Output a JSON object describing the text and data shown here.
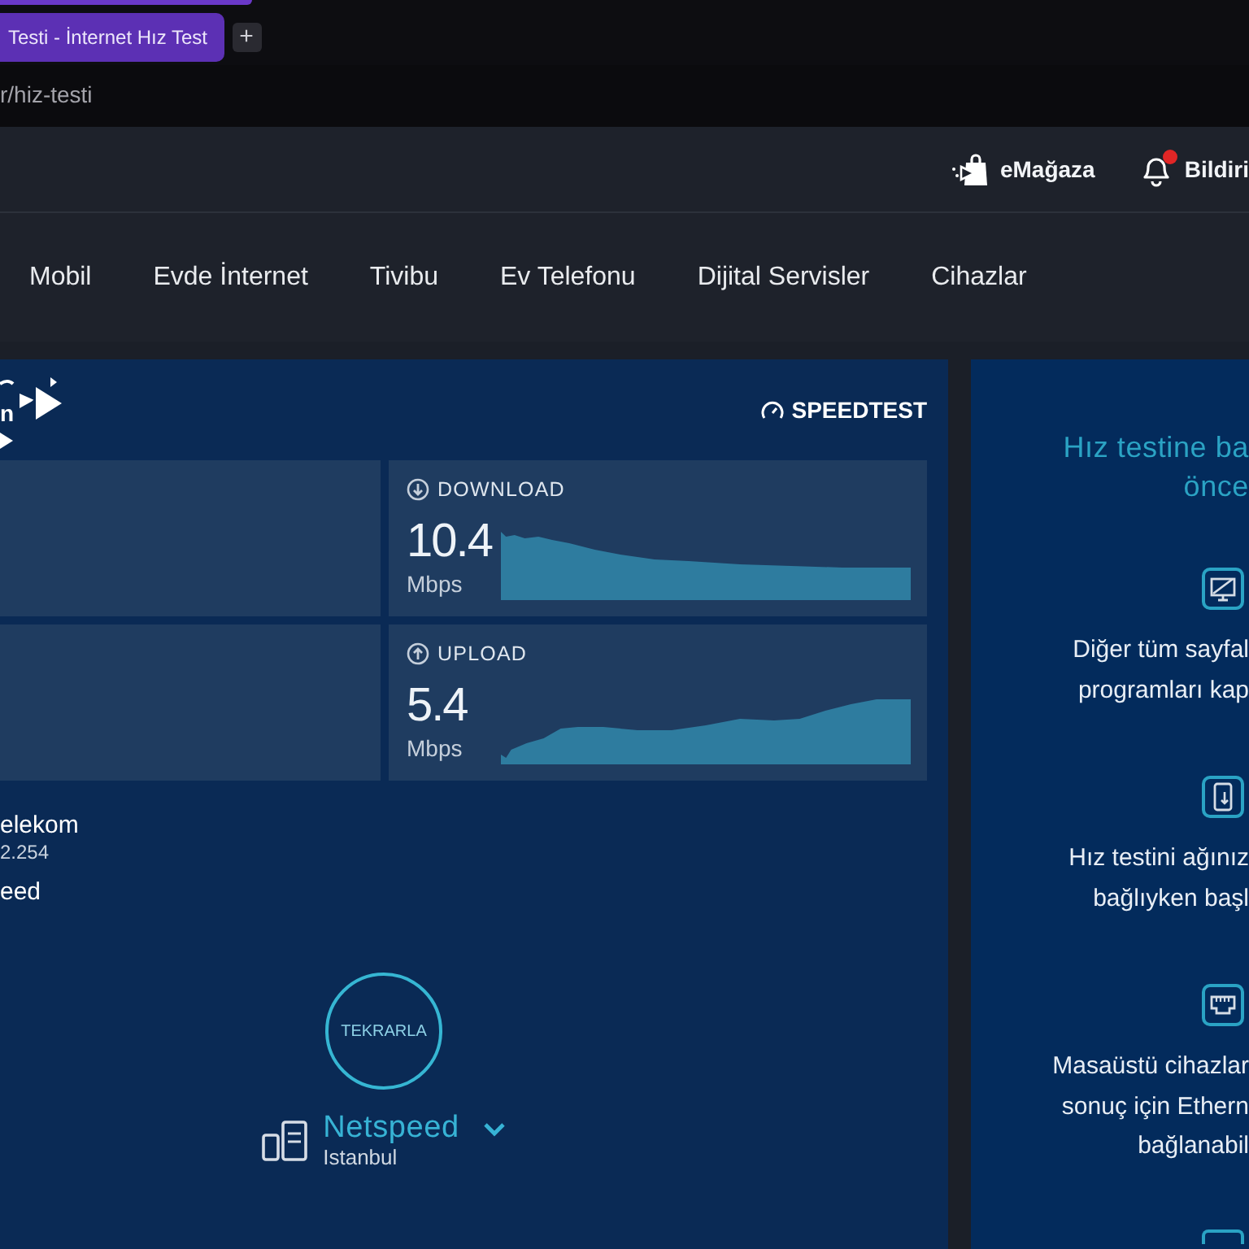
{
  "browser": {
    "tabs": [
      {
        "title": "Testi - İnternet Hız Test",
        "selected": true
      }
    ],
    "new_tab": "+",
    "address": "r/hiz-testi"
  },
  "header": {
    "links": [
      {
        "kind": "store",
        "label": "eMağaza"
      },
      {
        "kind": "notifications",
        "label": "Bildiri",
        "unread": true
      }
    ]
  },
  "nav": {
    "items": [
      "Mobil",
      "Evde İnternet",
      "Tivibu",
      "Ev Telefonu",
      "Dijital Servisler",
      "Cihazlar"
    ]
  },
  "speedtest": {
    "logo_text": "n",
    "title": "SPEEDTEST",
    "results": [
      {
        "kind": "empty"
      },
      {
        "kind": "download",
        "label": "DOWNLOAD",
        "value": "10.4",
        "unit": "Mbps"
      },
      {
        "kind": "empty"
      },
      {
        "kind": "upload",
        "label": "UPLOAD",
        "value": "5.4",
        "unit": "Mbps"
      }
    ],
    "isp": {
      "name": "elekom",
      "ip": "2.254"
    },
    "host": "eed",
    "retry": "TEKRARLA",
    "server": {
      "name": "Netspeed",
      "location": "Istanbul"
    }
  },
  "tips": {
    "title_lines": [
      "Hız testine ba",
      "önce"
    ],
    "items": [
      {
        "kind": "monitor",
        "lines": [
          "Diğer tüm sayfal",
          "programları kap"
        ]
      },
      {
        "kind": "phone",
        "lines": [
          "Hız testini ağınız",
          "bağlıyken başl"
        ]
      },
      {
        "kind": "ethernet",
        "lines": [
          "Masaüstü cihazlar",
          "sonuç için Ethern",
          "bağlanabil"
        ]
      },
      {
        "kind": "device"
      }
    ]
  }
}
